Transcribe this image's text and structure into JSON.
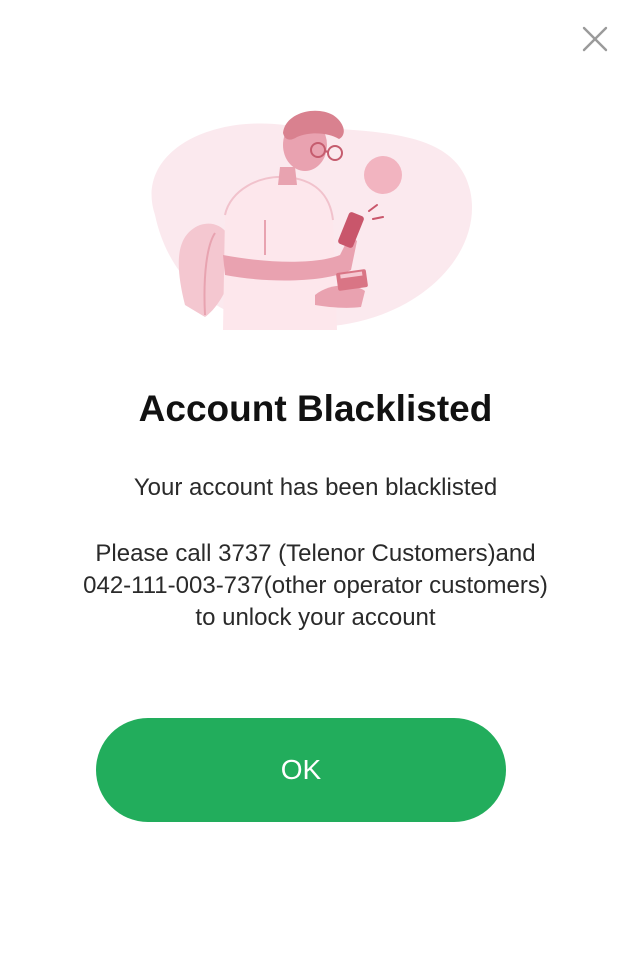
{
  "dialog": {
    "close_icon": "close-icon",
    "illustration": "person-checking-phone-illustration",
    "title": "Account Blacklisted",
    "subtitle": "Your account has been blacklisted",
    "message_lines": [
      "Please call 3737 (Telenor Customers)and",
      "042-111-003-737(other operator customers)",
      "to unlock your account"
    ],
    "ok_label": "OK"
  },
  "colors": {
    "accent": "#22ad5c",
    "illustration_pink": "#e8a3b0",
    "illustration_bg": "#fbe9ee"
  }
}
